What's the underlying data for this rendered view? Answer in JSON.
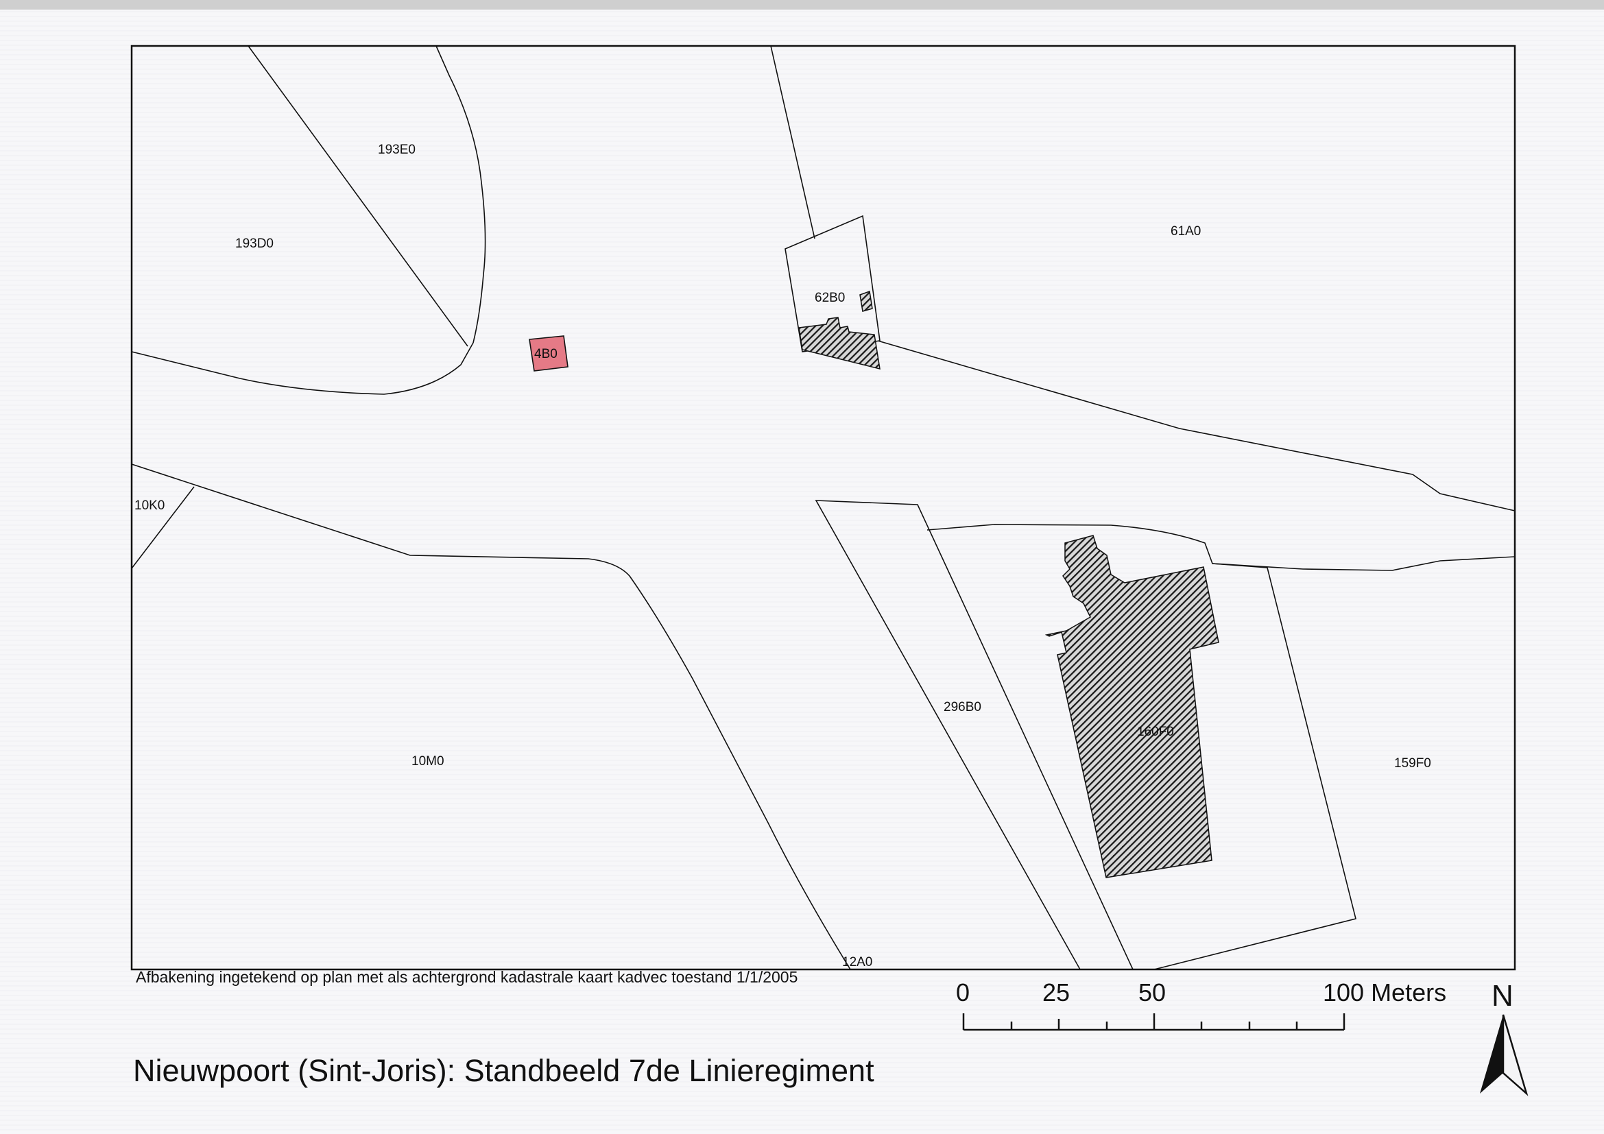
{
  "title": "Nieuwpoort (Sint-Joris): Standbeeld 7de Linieregiment",
  "note": "Afbakening ingetekend op plan met als achtergrond kadastrale kaart kadvec toestand 1/1/2005",
  "parcels": {
    "p193E0": "193E0",
    "p193D0": "193D0",
    "p61A0": "61A0",
    "p62B0": "62B0",
    "p4B0": "4B0",
    "p10K0": "10K0",
    "p296B0": "296B0",
    "p160F0": "160F0",
    "p10M0": "10M0",
    "p159F0": "159F0",
    "p12A0": "12A0"
  },
  "scale_bar": {
    "t0": "0",
    "t25": "25",
    "t50": "50",
    "t100": "100 Meters"
  },
  "north_arrow": {
    "label": "N"
  },
  "colors": {
    "highlight_fill": "#e57a86",
    "building_fill": "#2a2a2a",
    "line": "#111111"
  },
  "icons": [
    "north-arrow-icon"
  ]
}
